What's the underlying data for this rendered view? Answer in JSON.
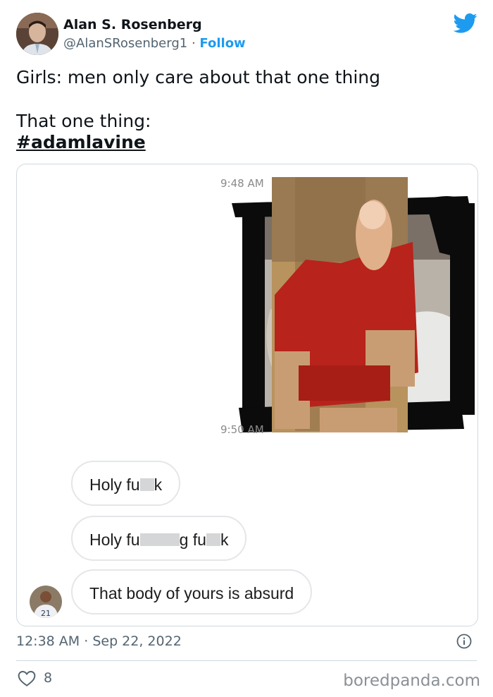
{
  "author": {
    "name": "Alan S. Rosenberg",
    "handle": "@AlanSRosenberg1",
    "separator": "·",
    "follow_label": "Follow"
  },
  "tweet": {
    "line1": "Girls: men only care about that one thing",
    "line2": "That one thing:",
    "hashtag": "#adamlavine"
  },
  "screenshot": {
    "time_top": "9:48 AM",
    "time_bottom": "9:50 AM",
    "messages": [
      {
        "pre": "Holy fu",
        "post": "k"
      },
      {
        "pre": "Holy fu",
        "mid": "g fu",
        "post": "k"
      },
      {
        "text": "That body of yours is absurd"
      }
    ],
    "jersey_number": "21"
  },
  "meta": {
    "time": "12:38 AM",
    "separator": "·",
    "date": "Sep 22, 2022",
    "like_count": "8",
    "watermark": "boredpanda.com"
  },
  "colors": {
    "accent": "#1d9bf0",
    "text": "#0f1419",
    "muted": "#536471"
  },
  "icons": [
    "twitter-bird-icon",
    "info-icon",
    "heart-icon"
  ]
}
